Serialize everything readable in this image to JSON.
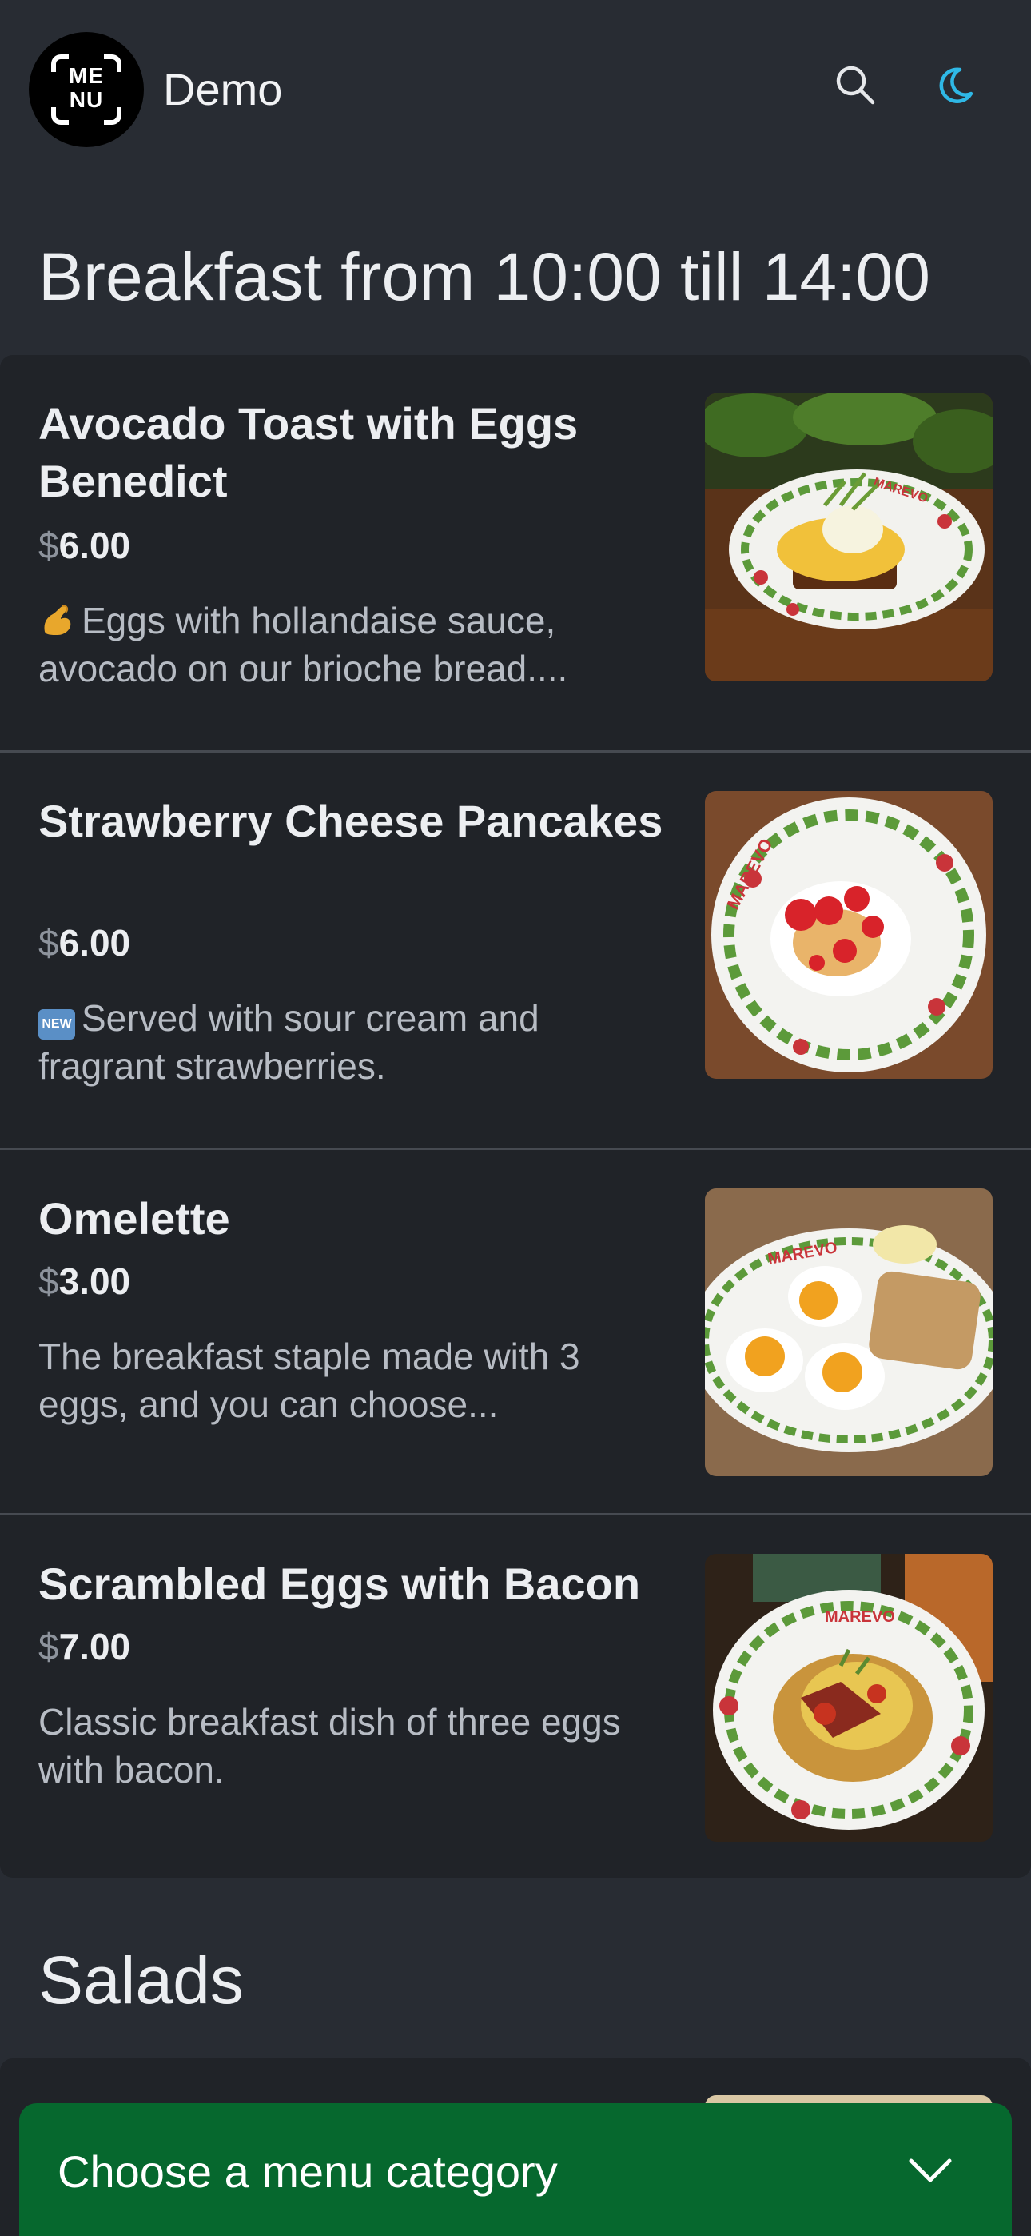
{
  "header": {
    "logo_text": "ME NU",
    "brand": "Demo",
    "search_icon": "search-icon",
    "theme_icon": "moon-icon",
    "theme_icon_color": "#2fb8e6"
  },
  "sections": [
    {
      "title": "Breakfast from 10:00 till 14:00",
      "items": [
        {
          "name": "Avocado Toast with Eggs Benedict",
          "currency": "$",
          "price": "6.00",
          "emoji": "pinching-hand-icon",
          "description": "Eggs with hollandaise sauce, avocado on our brioche bread....",
          "image": "avocado-toast-photo"
        },
        {
          "name": "Strawberry Cheese Pancakes",
          "currency": "$",
          "price": "6.00",
          "emoji": "new-badge-icon",
          "description": "Served with sour cream and fragrant strawberries.",
          "image": "strawberry-pancakes-photo"
        },
        {
          "name": "Omelette",
          "currency": "$",
          "price": "3.00",
          "description": "The breakfast staple made with 3 eggs, and you can choose...",
          "image": "fried-eggs-photo"
        },
        {
          "name": "Scrambled Eggs with Bacon",
          "currency": "$",
          "price": "7.00",
          "description": "Classic breakfast dish of three eggs with bacon.",
          "image": "scrambled-eggs-photo"
        }
      ]
    },
    {
      "title": "Salads",
      "items": []
    }
  ],
  "plate_text": "MAREVO",
  "new_badge_text": "NEW",
  "category_bar": {
    "label": "Choose a menu category",
    "icon": "chevron-down-icon",
    "color": "#06682e"
  }
}
